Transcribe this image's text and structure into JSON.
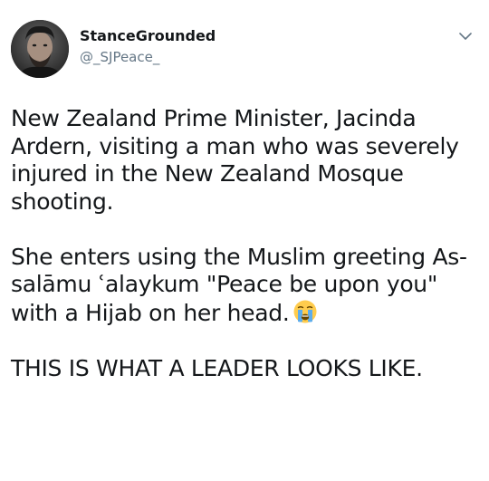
{
  "user": {
    "display_name": "StanceGrounded",
    "handle": "@_SJPeace_"
  },
  "menu": {
    "icon": "chevron-down-icon"
  },
  "tweet": {
    "paragraph_1": "New Zealand Prime Minister, Jacinda Ardern, visiting a man who was severely injured in the New Zealand Mosque shooting.",
    "paragraph_2": "She enters using the Muslim greeting As-salāmu ʿalaykum \"Peace be upon you\" with a Hijab on her head.",
    "paragraph_2_emoji": "loudly-crying-face-emoji",
    "paragraph_3": "THIS IS WHAT A LEADER LOOKS LIKE."
  },
  "colors": {
    "text": "#14171a",
    "secondary_text": "#657786",
    "chevron": "#657786",
    "background": "#ffffff"
  }
}
